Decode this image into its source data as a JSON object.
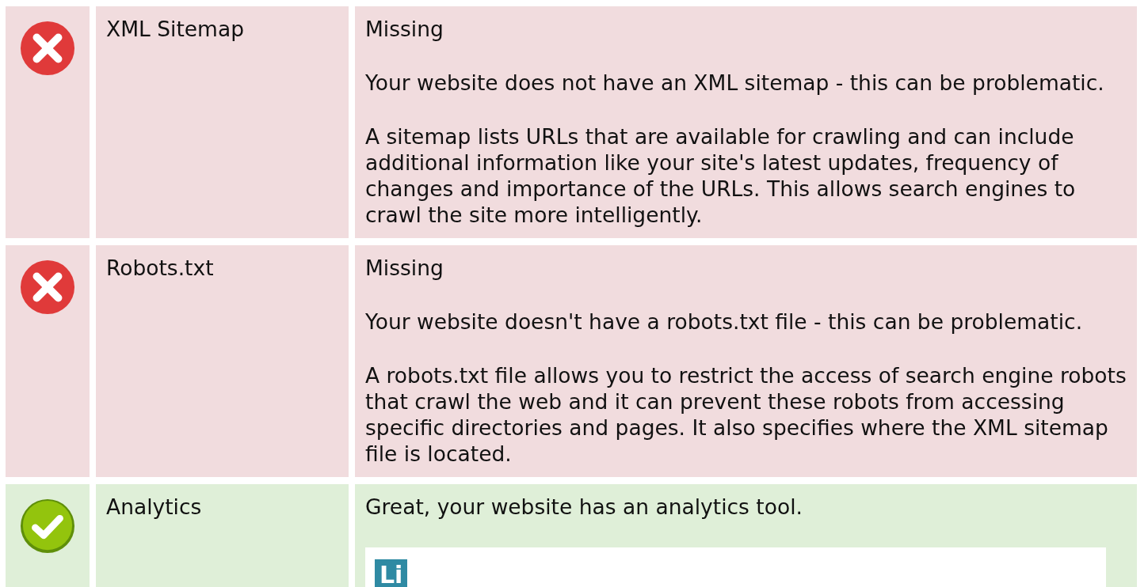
{
  "rows": [
    {
      "kind": "error",
      "label": "XML Sitemap",
      "result": "Missing",
      "paragraphs": [
        "Your website does not have an XML sitemap - this can be problematic.",
        "A sitemap lists URLs that are available for crawling and can include additional information like your site's latest updates, frequency of changes and importance of the URLs. This allows search engines to crawl the site more intelligently."
      ]
    },
    {
      "kind": "error",
      "label": "Robots.txt",
      "result": "Missing",
      "paragraphs": [
        "Your website doesn't have a robots.txt file - this can be problematic.",
        "A robots.txt file allows you to restrict the access of search engine robots that crawl the web and it can prevent these robots from accessing specific directories and pages. It also specifies where the XML sitemap file is located."
      ]
    },
    {
      "kind": "ok",
      "label": "Analytics",
      "result": "Great, your website has an analytics tool.",
      "tool_logo": "Li"
    }
  ]
}
